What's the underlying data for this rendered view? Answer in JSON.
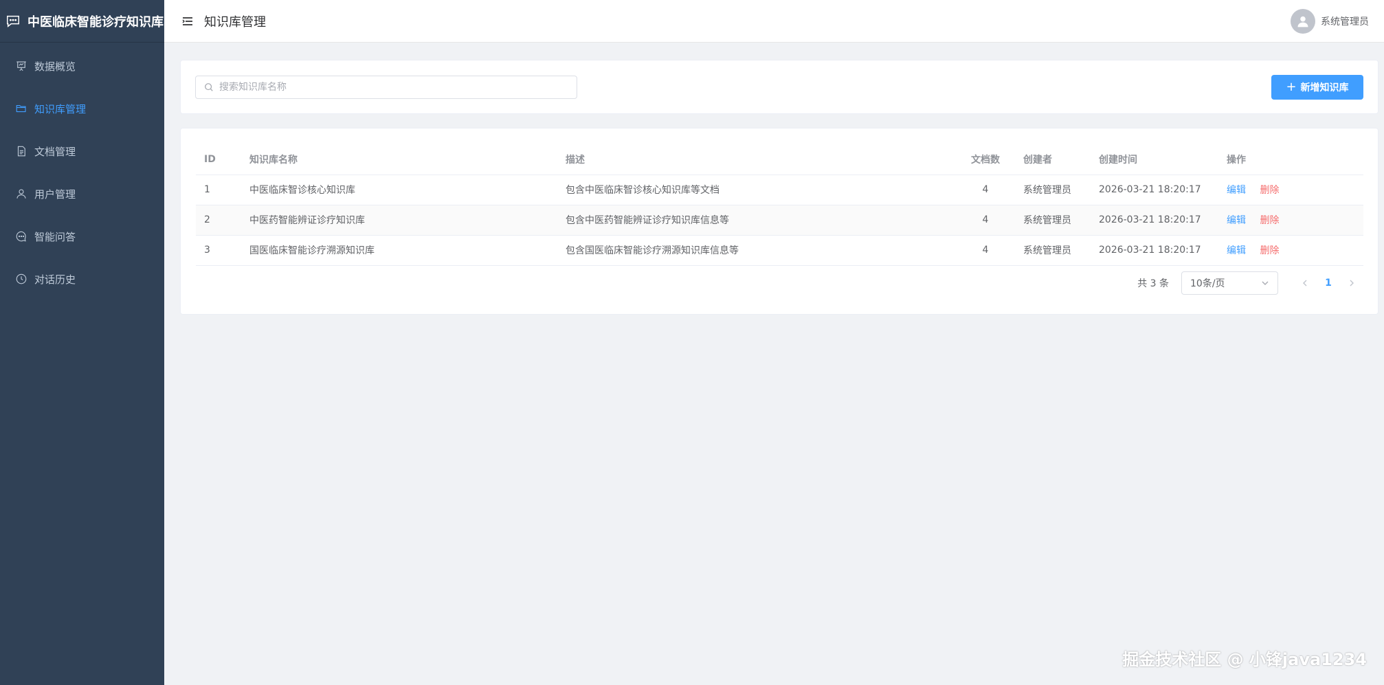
{
  "app": {
    "title": "中医临床智能诊疗知识库"
  },
  "colors": {
    "sidebar_bg": "#304156",
    "accent": "#409eff",
    "danger": "#f56c6c"
  },
  "sidebar": {
    "items": [
      {
        "label": "数据概览",
        "icon": "presentation-icon",
        "active": false
      },
      {
        "label": "知识库管理",
        "icon": "folder-open-icon",
        "active": true
      },
      {
        "label": "文档管理",
        "icon": "document-icon",
        "active": false
      },
      {
        "label": "用户管理",
        "icon": "user-icon",
        "active": false
      },
      {
        "label": "智能问答",
        "icon": "chat-icon",
        "active": false
      },
      {
        "label": "对话历史",
        "icon": "clock-icon",
        "active": false
      }
    ]
  },
  "header": {
    "breadcrumb": "知识库管理",
    "username": "系统管理员"
  },
  "toolbar": {
    "search_placeholder": "搜索知识库名称",
    "add_label": "新增知识库"
  },
  "table": {
    "headers": [
      "ID",
      "知识库名称",
      "描述",
      "文档数",
      "创建者",
      "创建时间",
      "操作"
    ],
    "edit_label": "编辑",
    "delete_label": "删除",
    "rows": [
      {
        "id": "1",
        "name": "中医临床智诊核心知识库",
        "desc": "包含中医临床智诊核心知识库等文档",
        "docs": "4",
        "creator": "系统管理员",
        "created": "2026-03-21 18:20:17"
      },
      {
        "id": "2",
        "name": "中医药智能辨证诊疗知识库",
        "desc": "包含中医药智能辨证诊疗知识库信息等",
        "docs": "4",
        "creator": "系统管理员",
        "created": "2026-03-21 18:20:17"
      },
      {
        "id": "3",
        "name": "国医临床智能诊疗溯源知识库",
        "desc": "包含国医临床智能诊疗溯源知识库信息等",
        "docs": "4",
        "creator": "系统管理员",
        "created": "2026-03-21 18:20:17"
      }
    ]
  },
  "pagination": {
    "total": "共 3 条",
    "page_size": "10条/页",
    "current_page": "1"
  },
  "watermark": "掘金技术社区 @ 小锋java1234"
}
